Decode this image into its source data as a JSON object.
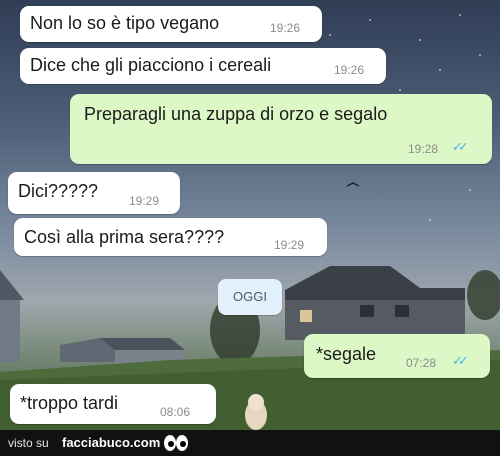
{
  "chat": {
    "messages": [
      {
        "direction": "in",
        "text": "Non lo so è tipo vegano",
        "time": "19:26"
      },
      {
        "direction": "in",
        "text": "Dice che gli piacciono i cereali",
        "time": "19:26"
      },
      {
        "direction": "out",
        "text": "Preparagli una zuppa di orzo e segalo",
        "time": "19:28",
        "status": "read"
      },
      {
        "direction": "in",
        "text": "Dici?????",
        "time": "19:29"
      },
      {
        "direction": "in",
        "text": "Così alla prima sera????",
        "time": "19:29"
      },
      {
        "direction": "out",
        "text": "*segale",
        "time": "07:28",
        "status": "read"
      },
      {
        "direction": "in",
        "text": "*troppo tardi",
        "time": "08:06"
      }
    ],
    "date_separator": "OGGI",
    "read_tick_color": "#4fb6ec",
    "outgoing_bubble_color": "#dcf8c6",
    "incoming_bubble_color": "#ffffff"
  },
  "watermark": {
    "prefix": "visto su",
    "brand": "facciabuco.com",
    "icon": "eyes-icon"
  }
}
